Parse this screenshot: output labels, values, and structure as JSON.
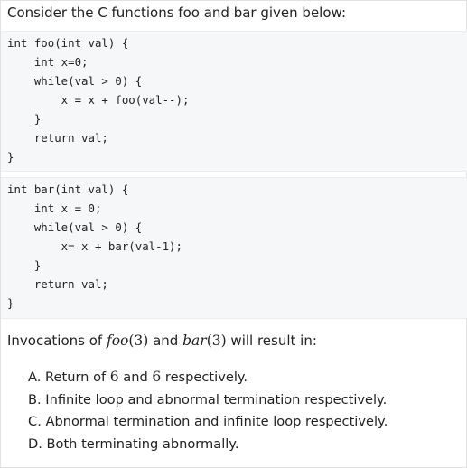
{
  "intro": "Consider the C functions foo and bar given below:",
  "code_foo": [
    "int foo(int val) {",
    "    int x=0;",
    "    while(val > 0) {",
    "        x = x + foo(val--);",
    "    }",
    "    return val;",
    "}"
  ],
  "code_bar": [
    "int bar(int val) {",
    "    int x = 0;",
    "    while(val > 0) {",
    "        x= x + bar(val-1);",
    "    }",
    "    return val;",
    "}"
  ],
  "question": {
    "prefix": "Invocations of ",
    "foo_name": "foo",
    "foo_arg": "(3)",
    "middle": " and ",
    "bar_name": "bar",
    "bar_arg": "(3)",
    "suffix": " will result in:"
  },
  "options": {
    "a": {
      "prefix": "A. Return of ",
      "n1": "6",
      "middle": " and ",
      "n2": "6",
      "suffix": " respectively."
    },
    "b": "B. Infinite loop and abnormal termination respectively.",
    "c": "C. Abnormal termination and infinite loop respectively.",
    "d": "D. Both terminating abnormally."
  }
}
